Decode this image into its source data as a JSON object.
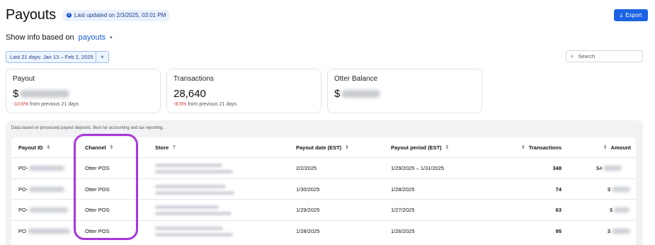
{
  "header": {
    "title": "Payouts",
    "last_updated": "Last updated on 2/3/2025, 03:01 PM",
    "export_label": "Export"
  },
  "info_row": {
    "label": "Show info based on",
    "selected": "payouts"
  },
  "filter_chip": {
    "label": "Last 21 days: Jan 13 – Feb 2, 2025",
    "close": "×"
  },
  "search": {
    "placeholder": "Search"
  },
  "cards": [
    {
      "title": "Payout",
      "value_prefix": "$",
      "change": "-10.6%",
      "change_suffix": "from previous 21 days"
    },
    {
      "title": "Transactions",
      "value": "28,640",
      "change": "-8.5%",
      "change_suffix": "from previous 21 days"
    },
    {
      "title": "Otter Balance",
      "value_prefix": "$"
    }
  ],
  "table": {
    "note": "Data based on processed payout deposits. Best for accounting and tax reporting.",
    "columns": {
      "payout_id": "Payout ID",
      "channel": "Channel",
      "store": "Store",
      "payout_date": "Payout date (EST)",
      "payout_period": "Payout period (EST)",
      "transactions": "Transactions",
      "amount": "Amount"
    },
    "rows": [
      {
        "payout_id": "PO-",
        "channel": "Otter POS",
        "payout_date": "2/2/2025",
        "payout_period": "1/29/2025 – 1/31/2025",
        "transactions": "348",
        "amount": "$4"
      },
      {
        "payout_id": "PO-",
        "channel": "Otter POS",
        "payout_date": "1/30/2025",
        "payout_period": "1/28/2025",
        "transactions": "74",
        "amount": "$"
      },
      {
        "payout_id": "PO-",
        "channel": "Otter POS",
        "payout_date": "1/29/2025",
        "payout_period": "1/27/2025",
        "transactions": "63",
        "amount": "$"
      },
      {
        "payout_id": "PO",
        "channel": "Otter POS",
        "payout_date": "1/28/2025",
        "payout_period": "1/26/2025",
        "transactions": "95",
        "amount": "$"
      }
    ]
  },
  "colors": {
    "accent": "#1b63e3",
    "negative": "#d23030",
    "highlight": "#a638d8"
  }
}
